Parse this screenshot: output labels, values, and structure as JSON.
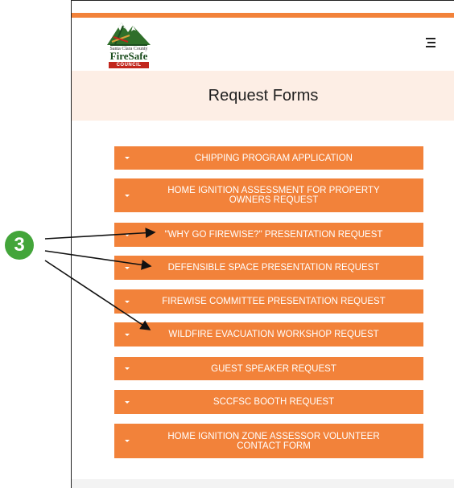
{
  "header": {
    "logo": {
      "tagline": "Santa Clara County",
      "brand": "FireSafe",
      "council": "COUNCIL"
    },
    "menu_icon": "hamburger-menu-icon"
  },
  "page": {
    "title": "Request Forms"
  },
  "forms": [
    {
      "label": "CHIPPING PROGRAM APPLICATION"
    },
    {
      "label": "HOME IGNITION ASSESSMENT FOR PROPERTY OWNERS REQUEST"
    },
    {
      "label": "\"WHY GO FIREWISE?\" PRESENTATION REQUEST"
    },
    {
      "label": "DEFENSIBLE SPACE PRESENTATION REQUEST"
    },
    {
      "label": "FIREWISE COMMITTEE PRESENTATION REQUEST"
    },
    {
      "label": "WILDFIRE EVACUATION WORKSHOP REQUEST"
    },
    {
      "label": "GUEST SPEAKER REQUEST"
    },
    {
      "label": "SCCFSC BOOTH REQUEST"
    },
    {
      "label": "HOME IGNITION ZONE ASSESSOR VOLUNTEER CONTACT FORM"
    }
  ],
  "callout": {
    "number": "3"
  },
  "colors": {
    "accent": "#f2823a",
    "title_band": "#fdeee5",
    "callout": "#43a53a",
    "logo_green": "#1b4d1e",
    "logo_red": "#c2261d"
  }
}
